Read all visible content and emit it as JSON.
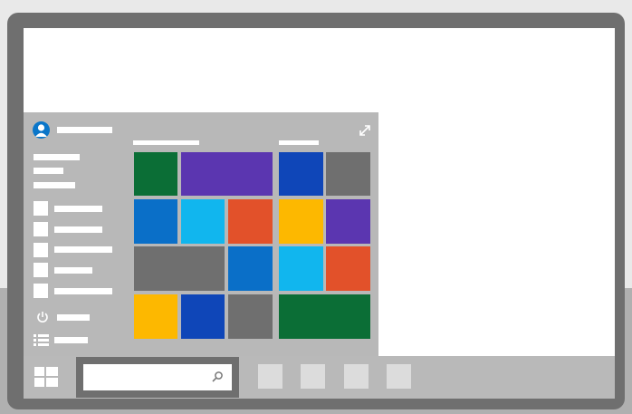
{
  "illustration": {
    "description_colors": {
      "frame": "#6f6f6f",
      "screen": "#ffffff",
      "taskbar": "#b9b9b9",
      "start_menu": "#b8b8b8",
      "accent": "#0a76c9"
    }
  },
  "start_menu": {
    "tiles": [
      {
        "name": "tile-green-1",
        "color": "#0b6e36"
      },
      {
        "name": "tile-purple-wide",
        "color": "#5b36b0"
      },
      {
        "name": "tile-blue-dark-1",
        "color": "#0f46b8"
      },
      {
        "name": "tile-gray-1",
        "color": "#6f6f6f"
      },
      {
        "name": "tile-blue-1",
        "color": "#0a6fc8"
      },
      {
        "name": "tile-cyan-1",
        "color": "#11b6ee"
      },
      {
        "name": "tile-orange-1",
        "color": "#e2512a"
      },
      {
        "name": "tile-yellow-1",
        "color": "#fdb800"
      },
      {
        "name": "tile-purple-1",
        "color": "#5b36b0"
      },
      {
        "name": "tile-gray-wide",
        "color": "#6f6f6f"
      },
      {
        "name": "tile-blue-2",
        "color": "#0a6fc8"
      },
      {
        "name": "tile-cyan-2",
        "color": "#11b6ee"
      },
      {
        "name": "tile-orange-2",
        "color": "#e2512a"
      },
      {
        "name": "tile-yellow-2",
        "color": "#fdb800"
      },
      {
        "name": "tile-blue-dark-2",
        "color": "#0f46b8"
      },
      {
        "name": "tile-gray-2",
        "color": "#6f6f6f"
      },
      {
        "name": "tile-green-wide",
        "color": "#0b6e36"
      }
    ],
    "icons": [
      "user-avatar-icon",
      "expand-icon",
      "power-icon",
      "all-apps-icon"
    ]
  },
  "taskbar": {
    "icons": [
      "windows-logo-icon",
      "search-icon",
      "taskbar-app-icon"
    ]
  }
}
